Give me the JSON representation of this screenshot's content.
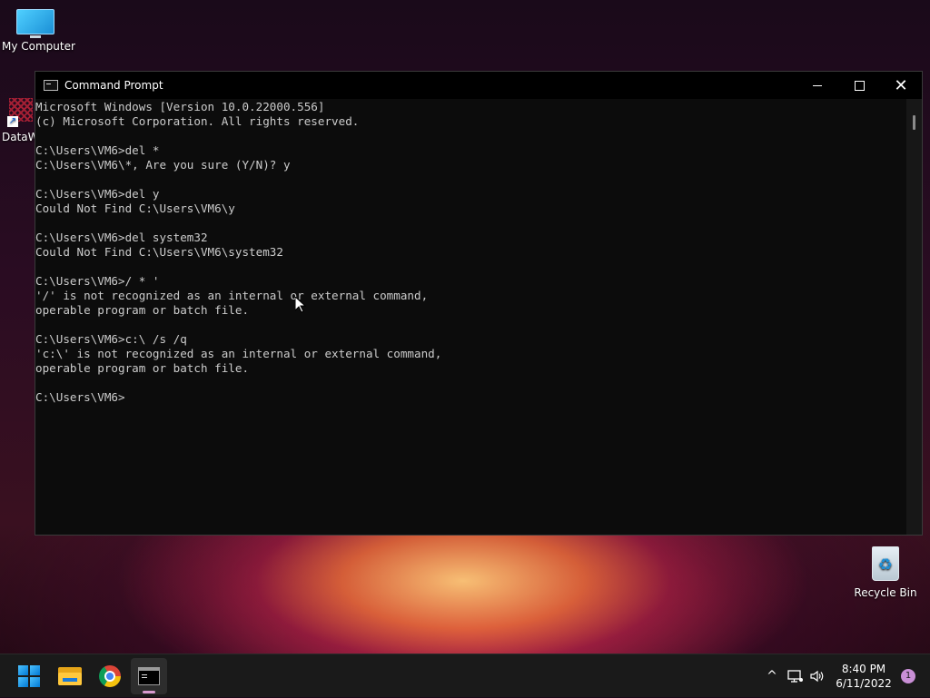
{
  "desktop": {
    "icons": [
      {
        "label": "My Computer",
        "icon": "monitor-icon"
      },
      {
        "label": "DataW",
        "icon": "dataw-shortcut-icon"
      },
      {
        "label": "Recycle Bin",
        "icon": "recycle-bin-icon"
      }
    ]
  },
  "window": {
    "title": "Command Prompt",
    "controls": {
      "minimize": "minimize-icon",
      "maximize": "maximize-icon",
      "close": "close-icon"
    },
    "console_lines": [
      "Microsoft Windows [Version 10.0.22000.556]",
      "(c) Microsoft Corporation. All rights reserved.",
      "",
      "C:\\Users\\VM6>del *",
      "C:\\Users\\VM6\\*, Are you sure (Y/N)? y",
      "",
      "C:\\Users\\VM6>del y",
      "Could Not Find C:\\Users\\VM6\\y",
      "",
      "C:\\Users\\VM6>del system32",
      "Could Not Find C:\\Users\\VM6\\system32",
      "",
      "C:\\Users\\VM6>/ * '",
      "'/' is not recognized as an internal or external command,",
      "operable program or batch file.",
      "",
      "C:\\Users\\VM6>c:\\ /s /q",
      "'c:\\' is not recognized as an internal or external command,",
      "operable program or batch file.",
      "",
      "C:\\Users\\VM6>"
    ]
  },
  "taskbar": {
    "apps": [
      {
        "name": "start",
        "icon": "windows-start-icon"
      },
      {
        "name": "file-explorer",
        "icon": "file-explorer-icon"
      },
      {
        "name": "chrome",
        "icon": "chrome-icon"
      },
      {
        "name": "command-prompt",
        "icon": "command-prompt-icon",
        "active": true
      }
    ],
    "tray": {
      "chevron": "^",
      "network_icon": "network-icon",
      "volume_icon": "volume-icon",
      "time": "8:40 PM",
      "date": "6/11/2022",
      "notification_count": "1"
    }
  },
  "colors": {
    "console_bg": "#0c0c0c",
    "console_fg": "#cccccc",
    "taskbar_bg": "#1a1a1a",
    "accent": "#0078d4"
  }
}
